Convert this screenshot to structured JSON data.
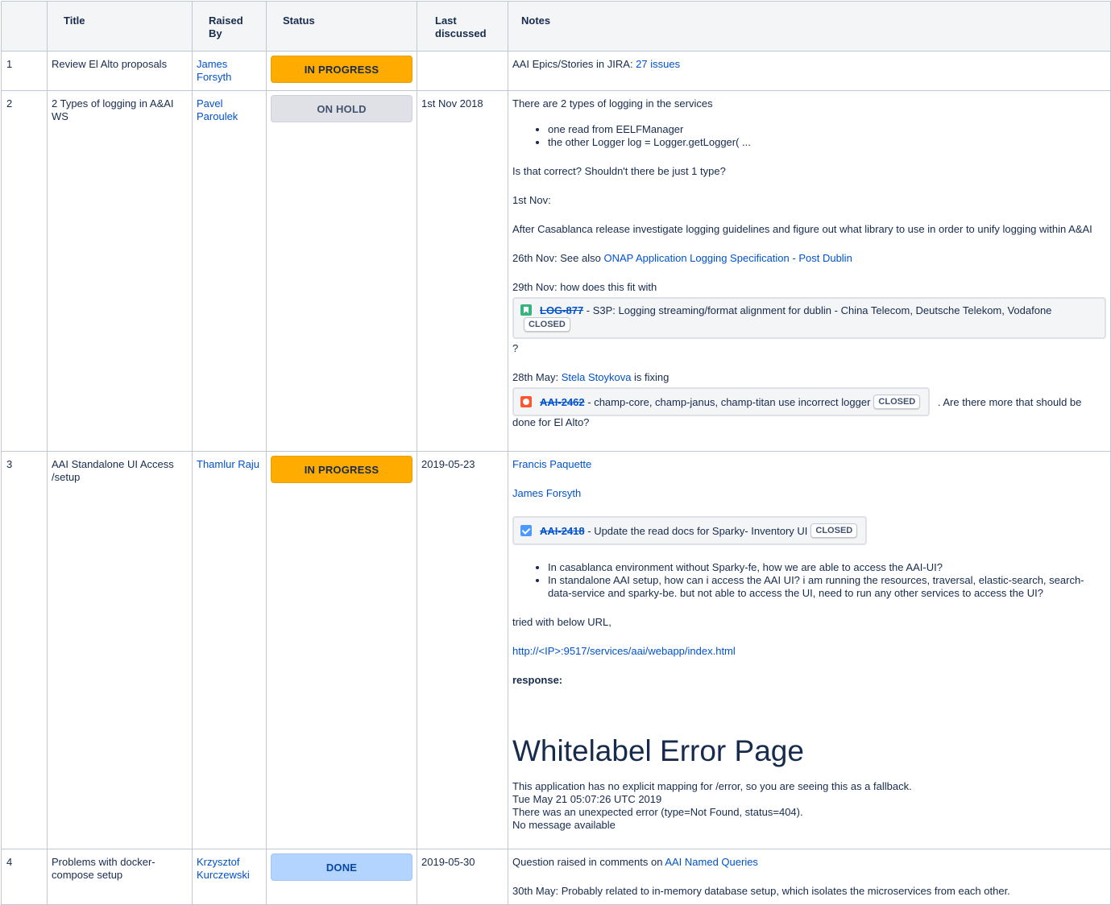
{
  "columns": {
    "num": "",
    "title": "Title",
    "raised_by": "Raised By",
    "status": "Status",
    "last_discussed": "Last discussed",
    "notes": "Notes"
  },
  "rows": [
    {
      "num": "1",
      "title": "Review El Alto proposals",
      "raised_by": "James Forsyth",
      "status": "IN PROGRESS",
      "last_discussed": "",
      "notes": {
        "prefix": "AAI Epics/Stories in JIRA: ",
        "link": "27 issues"
      }
    },
    {
      "num": "2",
      "title": "2 Types of logging in A&AI WS",
      "raised_by": "Pavel Paroulek",
      "status": "ON HOLD",
      "last_discussed": "1st Nov 2018",
      "notes": {
        "p1": "There are 2 types of logging in the services",
        "bullets": [
          "one read from EELFManager",
          "the other Logger log = Logger.getLogger( ..."
        ],
        "p2": "Is that correct? Shouldn't there be just 1 type?",
        "p3": "1st Nov:",
        "p4": "After Casablanca release investigate logging guidelines and figure out what library to use in order to unify logging within A&AI",
        "p5_prefix": "26th Nov: See also ",
        "p5_link": "ONAP Application Logging Specification - Post Dublin",
        "p6": "29th Nov: how does this fit with",
        "jira1": {
          "key": "LOG-877",
          "summary": " - S3P: Logging streaming/format alignment for dublin - China Telecom, Deutsche Telekom, Vodafone",
          "status": "CLOSED",
          "icon": "story-icon"
        },
        "after_jira1": "?",
        "p7_prefix": "28th May: ",
        "p7_link": "Stela Stoykova",
        "p7_suffix": " is fixing",
        "jira2": {
          "key": "AAI-2462",
          "summary": " - champ-core, champ-janus, champ-titan use incorrect logger",
          "status": "CLOSED",
          "icon": "bug-icon"
        },
        "after_jira2": ". Are there more that should be done for El Alto?"
      }
    },
    {
      "num": "3",
      "title": "AAI Standalone UI Access /setup",
      "raised_by": "Thamlur Raju",
      "status": "IN PROGRESS",
      "last_discussed": "2019-05-23",
      "notes": {
        "mention1": "Francis Paquette",
        "mention2": "James Forsyth",
        "jira": {
          "key": "AAI-2418",
          "summary": " - Update the read docs for Sparky- Inventory UI",
          "status": "CLOSED",
          "icon": "task-icon"
        },
        "bullets": [
          "In casablanca environment without Sparky-fe, how we are able to access the AAI-UI?",
          "In standalone AAI setup, how can i access the AAI UI? i am running the resources, traversal, elastic-search, search-data-service and sparky-be. but not able to access the UI, need to run any other services to access the UI?"
        ],
        "p1": "tried with below URL,",
        "url": "http://<IP>:9517/services/aai/webapp/index.html",
        "response_label": "response:",
        "error_title": "Whitelabel Error Page",
        "error_lines": [
          "This application has no explicit mapping for /error, so you are seeing this as a fallback.",
          "Tue May 21 05:07:26 UTC 2019",
          "There was an unexpected error (type=Not Found, status=404).",
          "No message available"
        ]
      }
    },
    {
      "num": "4",
      "title": "Problems with docker-compose setup",
      "raised_by": "Krzysztof Kurczewski",
      "status": "DONE",
      "last_discussed": "2019-05-30",
      "notes": {
        "p1_prefix": "Question raised in comments on ",
        "p1_link": "AAI Named Queries",
        "p2": "30th May: Probably related to in-memory database setup, which isolates the microservices from each other."
      }
    }
  ],
  "colors": {
    "in_progress": "#ffab00",
    "on_hold": "#dfe1e6",
    "done": "#b3d4ff",
    "link": "#0052cc"
  }
}
